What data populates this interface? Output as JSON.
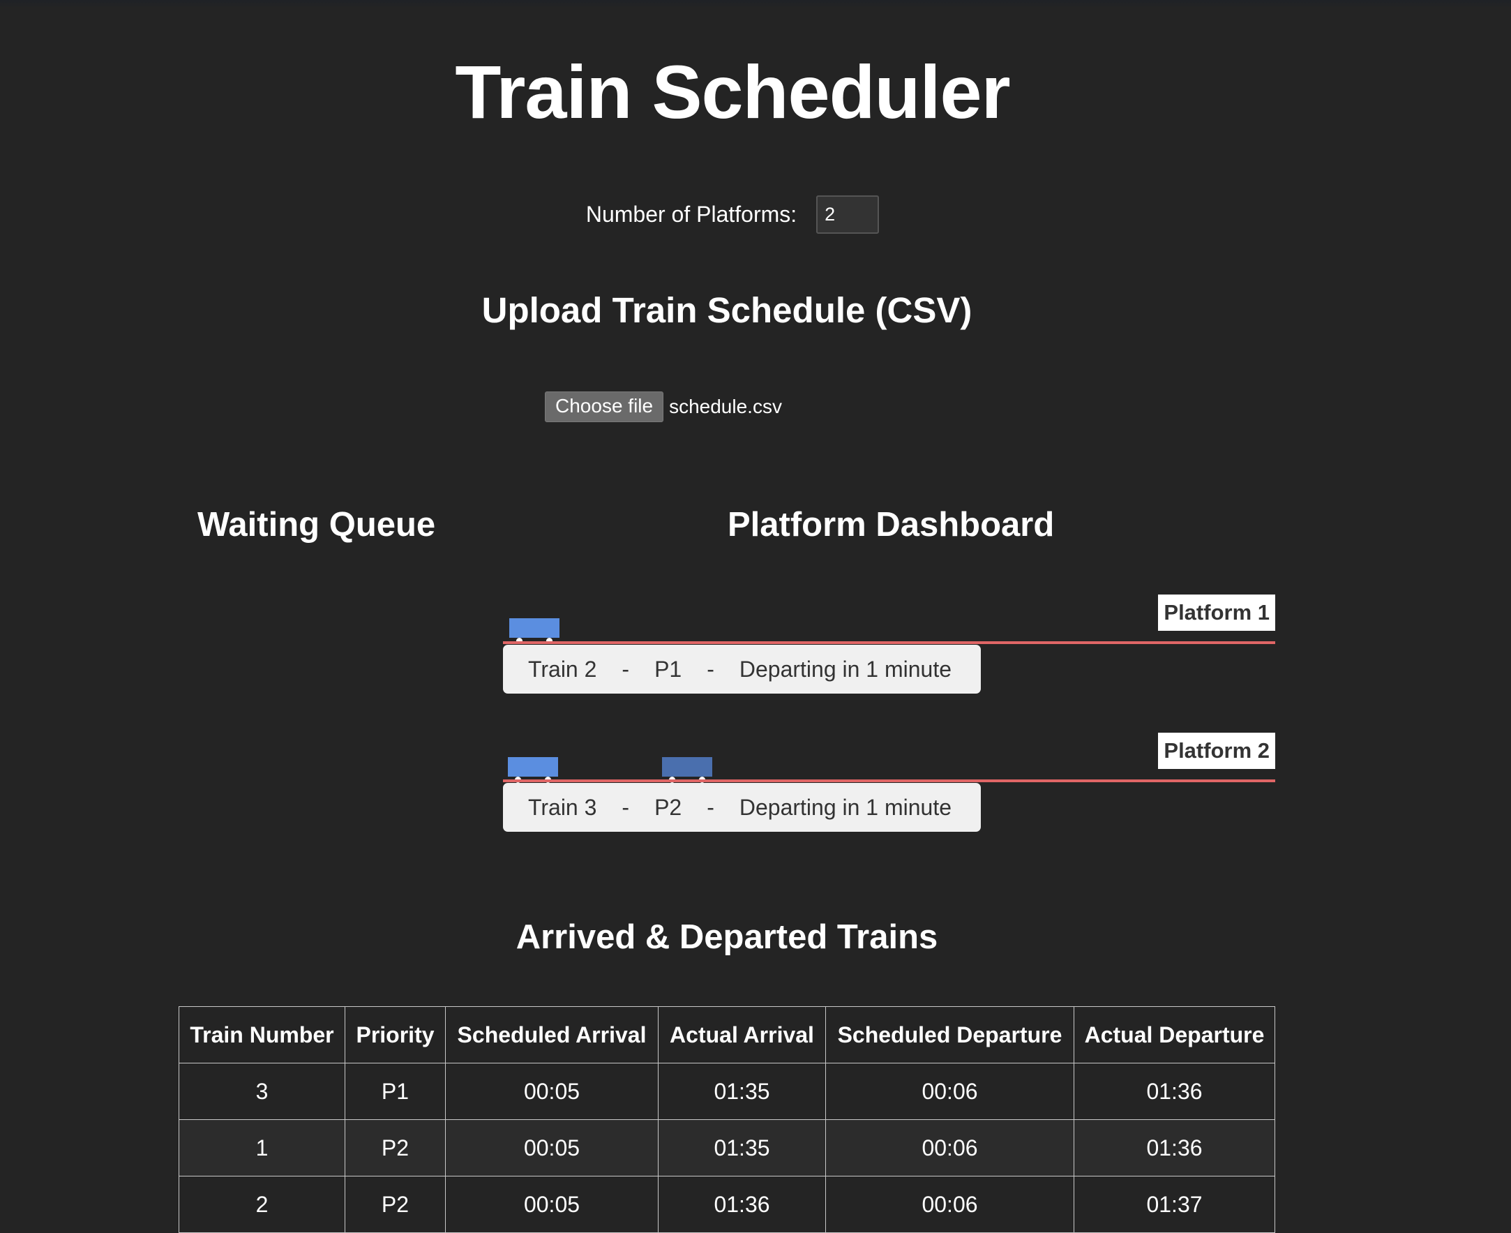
{
  "title": "Train Scheduler",
  "platform_count": {
    "label": "Number of Platforms:",
    "value": "2"
  },
  "upload": {
    "heading": "Upload Train Schedule (CSV)",
    "button_label": "Choose file",
    "file_name": "schedule.csv"
  },
  "waiting_queue": {
    "heading": "Waiting Queue"
  },
  "dashboard": {
    "heading": "Platform Dashboard",
    "platforms": [
      {
        "label": "Platform 1",
        "card": {
          "train": "Train 2",
          "sep": "-",
          "platform": "P1",
          "status": "Departing in 1 minute"
        }
      },
      {
        "label": "Platform 2",
        "card": {
          "train": "Train 3",
          "sep": "-",
          "platform": "P2",
          "status": "Departing in 1 minute"
        }
      }
    ]
  },
  "arrived": {
    "heading": "Arrived & Departed Trains",
    "columns": [
      "Train Number",
      "Priority",
      "Scheduled Arrival",
      "Actual Arrival",
      "Scheduled Departure",
      "Actual Departure"
    ],
    "rows": [
      [
        "3",
        "P1",
        "00:05",
        "01:35",
        "00:06",
        "01:36"
      ],
      [
        "1",
        "P2",
        "00:05",
        "01:35",
        "00:06",
        "01:36"
      ],
      [
        "2",
        "P2",
        "00:05",
        "01:36",
        "00:06",
        "01:37"
      ]
    ]
  },
  "colors": {
    "background": "#242424",
    "track": "#e06666",
    "train": "#5b8ee0",
    "train_secondary": "#4a6fae",
    "card": "#f0f0f0"
  }
}
